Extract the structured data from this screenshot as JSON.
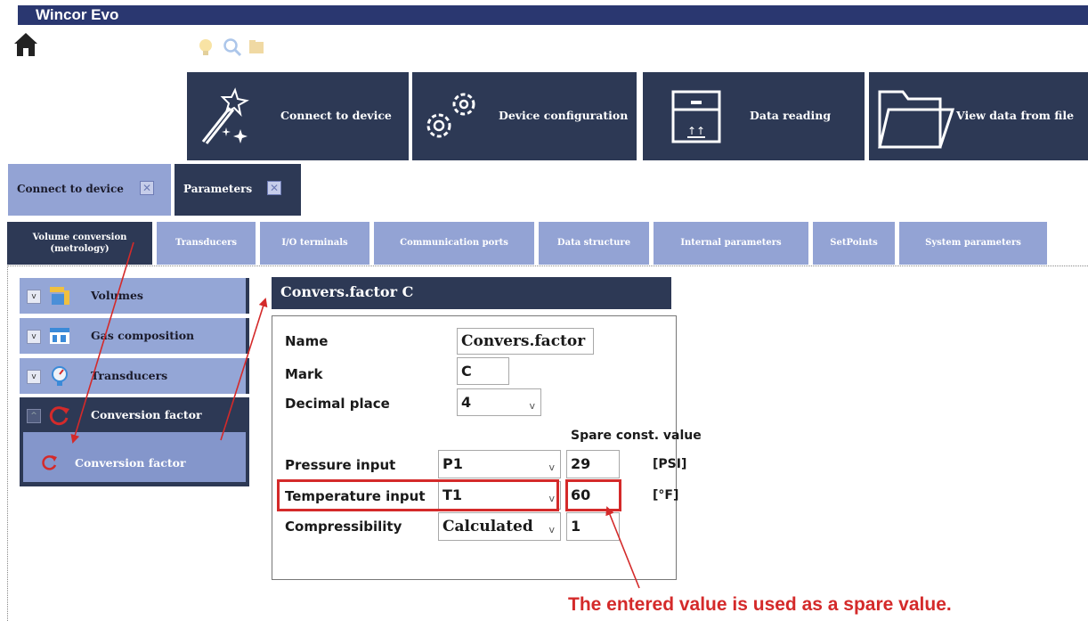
{
  "app": {
    "title": "Wincor Evo"
  },
  "toolbar_icons": [
    "home-icon",
    "lightbulb-icon",
    "zoom-icon",
    "folder-icon"
  ],
  "actions": [
    {
      "label": "Connect to device",
      "icon": "magic-wand-icon"
    },
    {
      "label": "Device configuration",
      "icon": "gears-icon"
    },
    {
      "label": "Data reading",
      "icon": "box-icon"
    },
    {
      "label": "View data from file",
      "icon": "folder-icon"
    }
  ],
  "doc_tabs": [
    {
      "label": "Connect to device",
      "active": false
    },
    {
      "label": "Parameters",
      "active": true
    }
  ],
  "sub_tabs": [
    {
      "label_line1": "Volume conversion",
      "label_line2": "(metrology)",
      "active": true
    },
    {
      "label": "Transducers"
    },
    {
      "label": "I/O terminals"
    },
    {
      "label": "Communication ports"
    },
    {
      "label": "Data structure"
    },
    {
      "label": "Internal parameters"
    },
    {
      "label": "SetPoints"
    },
    {
      "label": "System parameters"
    }
  ],
  "sidebar": {
    "items": [
      {
        "label": "Volumes",
        "icon": "volumes-icon"
      },
      {
        "label": "Gas composition",
        "icon": "table-icon"
      },
      {
        "label": "Transducers",
        "icon": "gauge-icon"
      },
      {
        "label": "Conversion factor",
        "icon": "refresh-icon",
        "selected": true
      }
    ],
    "subitem": {
      "label": "Conversion factor",
      "icon": "refresh-icon"
    }
  },
  "panel": {
    "title": "Convers.factor C",
    "name_label": "Name",
    "name_value": "Convers.factor",
    "mark_label": "Mark",
    "mark_value": "C",
    "decimal_label": "Decimal place",
    "decimal_value": "4",
    "spare_header": "Spare const. value",
    "rows": [
      {
        "label": "Pressure input",
        "select": "P1",
        "spare": "29",
        "unit": "[PSI]"
      },
      {
        "label": "Temperature input",
        "select": "T1",
        "spare": "60",
        "unit": "[°F]"
      },
      {
        "label": "Compressibility",
        "select": "Calculated",
        "spare": "1",
        "unit": ""
      }
    ]
  },
  "annotation": "The entered value is used as a spare value.",
  "colors": {
    "titlebar": "#2a3770",
    "dark": "#2d3955",
    "light": "#93a3d4",
    "highlight": "#d42a2a"
  }
}
